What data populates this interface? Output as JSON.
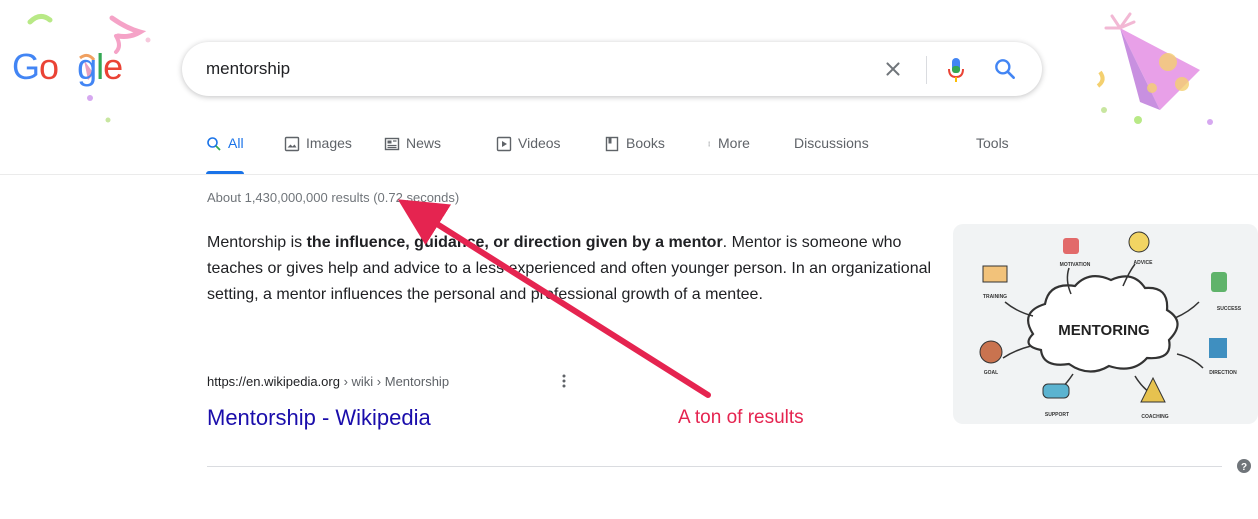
{
  "logo": {
    "text_g": "G",
    "text_o": "o",
    "text_gap": "o",
    "text_g2": "g",
    "text_l": "l",
    "text_e": "e"
  },
  "search": {
    "query": "mentorship"
  },
  "tabs": [
    {
      "label": "All",
      "icon": "search-icon",
      "active": true
    },
    {
      "label": "Images",
      "icon": "image-icon"
    },
    {
      "label": "News",
      "icon": "news-icon"
    },
    {
      "label": "Videos",
      "icon": "video-icon"
    },
    {
      "label": "Books",
      "icon": "book-icon"
    },
    {
      "label": "More",
      "icon": "more-vert-icon"
    },
    {
      "label": "Discussions"
    }
  ],
  "tools_label": "Tools",
  "result_stats": "About 1,430,000,000 results (0.72 seconds)",
  "snippet": {
    "part1": "Mentorship is ",
    "bold": "the influence, guidance, or direction given by a mentor",
    "part2": ". Mentor is someone who teaches or gives help and advice to a less experienced and often younger person. In an organizational setting, a mentor influences the personal and professional growth of a mentee."
  },
  "result": {
    "cite_url": "https://en.wikipedia.org",
    "cite_path": " › wiki › Mentorship",
    "title": "Mentorship - Wikipedia"
  },
  "knowledge_image": {
    "center_label": "MENTORING",
    "labels": [
      "MOTIVATION",
      "ADVICE",
      "TRAINING",
      "SUCCESS",
      "GOAL",
      "DIRECTION",
      "SUPPORT",
      "COACHING"
    ]
  },
  "annotation": {
    "text": "A ton of results",
    "color": "#e52450"
  },
  "colors": {
    "link": "#1a0dab",
    "accent": "#1a73e8",
    "muted": "#70757a"
  }
}
